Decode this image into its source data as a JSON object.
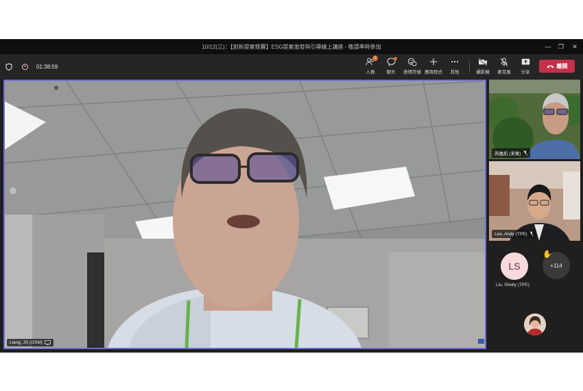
{
  "window": {
    "title": "10/12(三)：【創新提案競賽】ESG提案激發與引導線上講座 - 敬請準時參加",
    "controls": [
      "—",
      "❐",
      "✕"
    ]
  },
  "toolbar": {
    "timer": "01:38:59",
    "people_label": "人員",
    "people_badge": "1",
    "chat_label": "聊天",
    "reactions_label": "表情符號",
    "apps_label": "應用程式",
    "more_label": "其他",
    "camera_label": "攝影機",
    "mic_label": "麥克風",
    "share_label": "分享",
    "leave_label": "離開"
  },
  "main_speaker": {
    "name": "Liang, JS (GSM)"
  },
  "participants": {
    "p1_name": "芮嘉航 (來賓)",
    "p2_name": "Lee, Andy (TPE)",
    "p3_initials": "LS",
    "p3_name": "Liu, Shelly (TPE)",
    "overflow_count": "+114",
    "raised_hand_icon": "✋"
  },
  "colors": {
    "accent_border": "#6f6fd8",
    "leave_red": "#c4314b",
    "badge_orange": "#e36a2d",
    "toolbar_bg": "#252525"
  }
}
